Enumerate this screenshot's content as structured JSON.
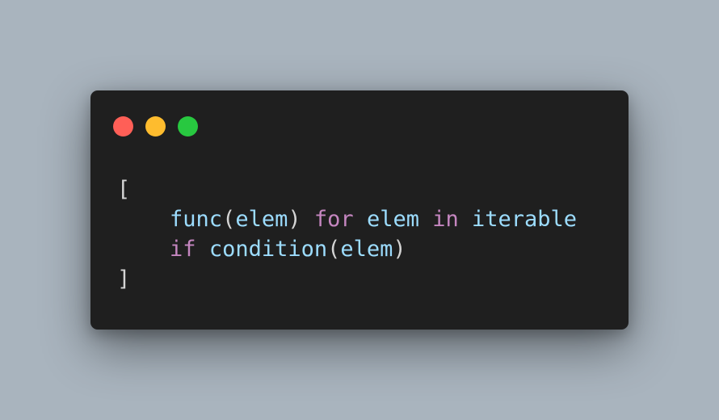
{
  "colors": {
    "background": "#a9b4be",
    "window": "#1f1f1f",
    "close": "#ff5f57",
    "minimize": "#febc2e",
    "maximize": "#28c840",
    "identifier": "#9cdcfe",
    "punctuation": "#d4d4d4",
    "keyword": "#c586c0"
  },
  "window": {
    "controls": [
      {
        "name": "close-button-icon",
        "color": "#ff5f57"
      },
      {
        "name": "minimize-button-icon",
        "color": "#febc2e"
      },
      {
        "name": "maximize-button-icon",
        "color": "#28c840"
      }
    ]
  },
  "code": {
    "lines": [
      [
        {
          "text": "[",
          "kind": "punctuation"
        }
      ],
      [
        {
          "text": "    ",
          "kind": "whitespace"
        },
        {
          "text": "func",
          "kind": "identifier"
        },
        {
          "text": "(",
          "kind": "punctuation"
        },
        {
          "text": "elem",
          "kind": "identifier"
        },
        {
          "text": ")",
          "kind": "punctuation"
        },
        {
          "text": " ",
          "kind": "whitespace"
        },
        {
          "text": "for",
          "kind": "keyword"
        },
        {
          "text": " ",
          "kind": "whitespace"
        },
        {
          "text": "elem",
          "kind": "identifier"
        },
        {
          "text": " ",
          "kind": "whitespace"
        },
        {
          "text": "in",
          "kind": "keyword"
        },
        {
          "text": " ",
          "kind": "whitespace"
        },
        {
          "text": "iterable",
          "kind": "identifier"
        }
      ],
      [
        {
          "text": "    ",
          "kind": "whitespace"
        },
        {
          "text": "if",
          "kind": "keyword"
        },
        {
          "text": " ",
          "kind": "whitespace"
        },
        {
          "text": "condition",
          "kind": "identifier"
        },
        {
          "text": "(",
          "kind": "punctuation"
        },
        {
          "text": "elem",
          "kind": "identifier"
        },
        {
          "text": ")",
          "kind": "punctuation"
        }
      ],
      [
        {
          "text": "]",
          "kind": "punctuation"
        }
      ]
    ]
  }
}
